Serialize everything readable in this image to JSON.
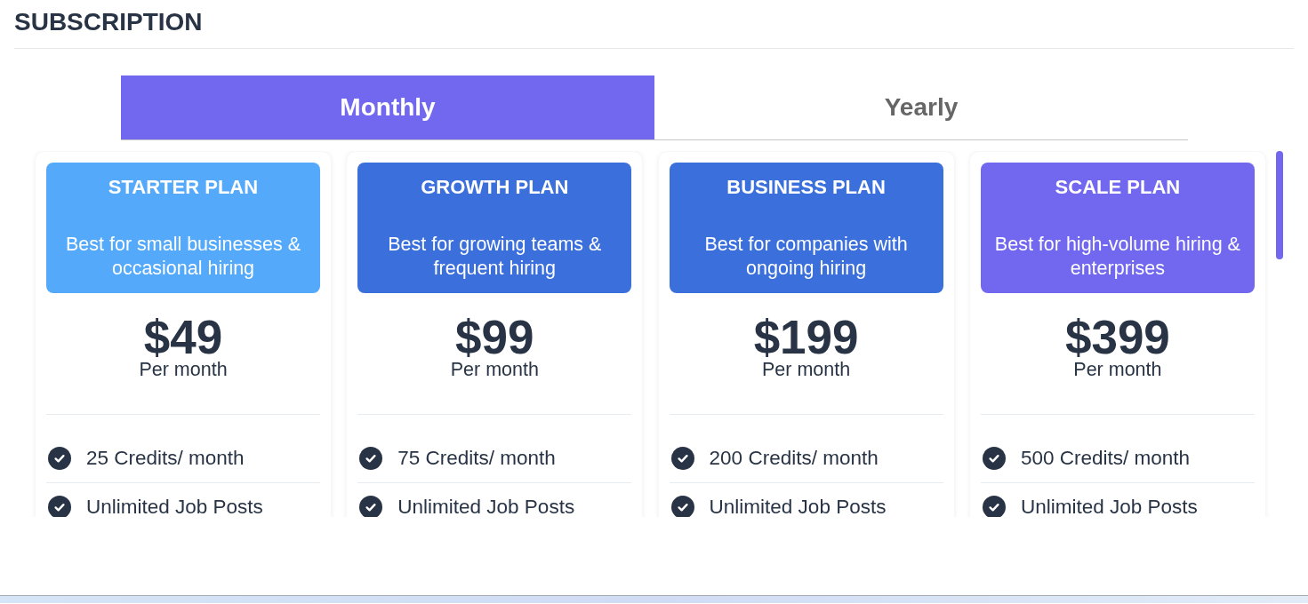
{
  "page": {
    "title": "SUBSCRIPTION"
  },
  "billing_tabs": [
    {
      "label": "Monthly",
      "selected": true
    },
    {
      "label": "Yearly",
      "selected": false
    }
  ],
  "plans": [
    {
      "name": "STARTER PLAN",
      "description": "Best for small businesses & occasional hiring",
      "color": "#54a9fa",
      "price": "$49",
      "period": "Per month",
      "features": [
        "25 Credits/ month",
        "Unlimited Job Posts"
      ]
    },
    {
      "name": "GROWTH PLAN",
      "description": "Best for growing teams & frequent hiring",
      "color": "#3b6fdc",
      "price": "$99",
      "period": "Per month",
      "features": [
        "75 Credits/ month",
        "Unlimited Job Posts"
      ]
    },
    {
      "name": "BUSINESS PLAN",
      "description": "Best for companies with ongoing hiring",
      "color": "#3b6fdc",
      "price": "$199",
      "period": "Per month",
      "features": [
        "200 Credits/ month",
        "Unlimited Job Posts"
      ]
    },
    {
      "name": "SCALE PLAN",
      "description": "Best for high-volume hiring & enterprises",
      "color": "#7267ef",
      "price": "$399",
      "period": "Per month",
      "features": [
        "500 Credits/ month",
        "Unlimited Job Posts"
      ]
    }
  ]
}
